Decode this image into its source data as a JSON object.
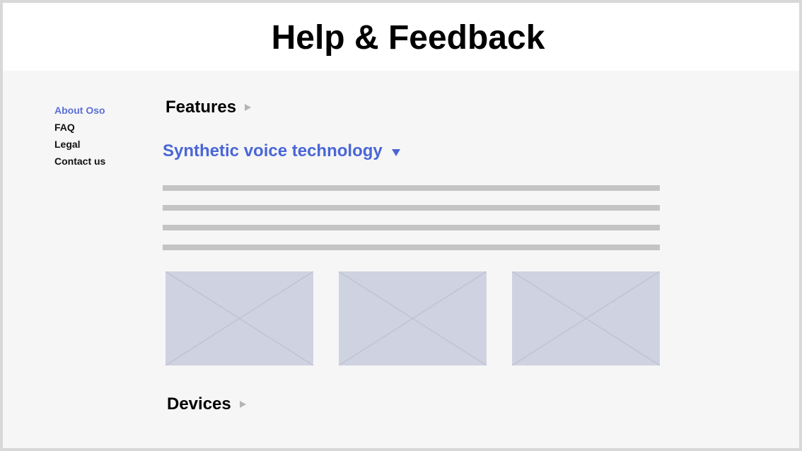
{
  "header": {
    "title": "Help & Feedback"
  },
  "sidebar": {
    "items": [
      {
        "label": "About Oso",
        "active": true
      },
      {
        "label": "FAQ",
        "active": false
      },
      {
        "label": "Legal",
        "active": false
      },
      {
        "label": "Contact us",
        "active": false
      }
    ]
  },
  "sections": [
    {
      "title": "Features",
      "expanded": false
    },
    {
      "title": "Synthetic voice technology",
      "expanded": true
    },
    {
      "title": "Devices",
      "expanded": false
    }
  ],
  "content": {
    "text_placeholder_lines": 4,
    "image_placeholders": 3
  },
  "colors": {
    "accent": "#4a66d6",
    "sidebar_active": "#5b6fd6",
    "background": "#f6f6f6",
    "header_background": "#ffffff",
    "placeholder_line": "#c4c4c4",
    "image_placeholder": "#cfd2e0"
  },
  "icons": {
    "collapsed": "triangle-right-icon",
    "expanded": "triangle-down-icon",
    "image": "image-placeholder-icon"
  }
}
